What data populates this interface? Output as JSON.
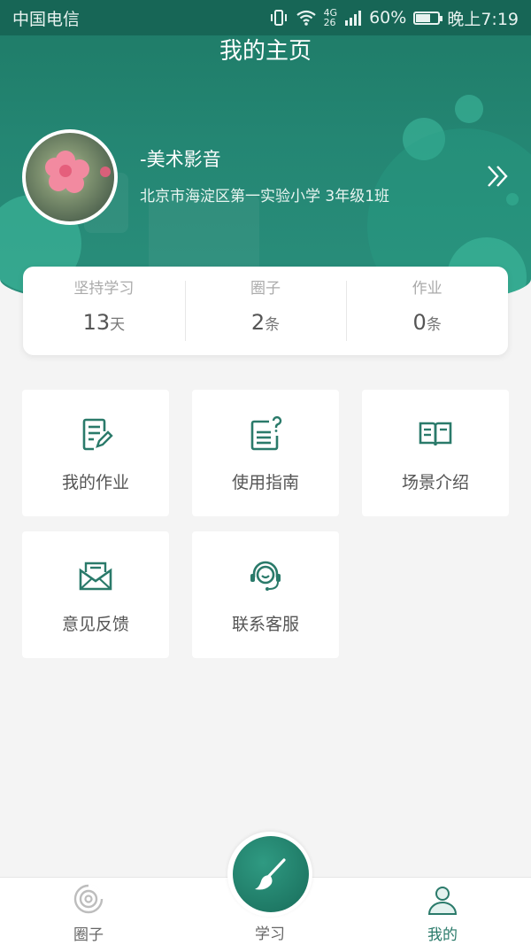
{
  "status_bar": {
    "carrier": "中国电信",
    "network_top": "4G",
    "network_bottom": "26",
    "battery": "60%",
    "time": "晚上7:19"
  },
  "header": {
    "title": "我的主页"
  },
  "profile": {
    "name": "-美术影音",
    "school": "北京市海淀区第一实验小学 3年级1班"
  },
  "stats": [
    {
      "label": "坚持学习",
      "value": "13",
      "unit": "天"
    },
    {
      "label": "圈子",
      "value": "2",
      "unit": "条"
    },
    {
      "label": "作业",
      "value": "0",
      "unit": "条"
    }
  ],
  "menu": [
    {
      "label": "我的作业",
      "icon": "edit-document-icon"
    },
    {
      "label": "使用指南",
      "icon": "guide-question-icon"
    },
    {
      "label": "场景介绍",
      "icon": "open-book-icon"
    },
    {
      "label": "意见反馈",
      "icon": "envelope-icon"
    },
    {
      "label": "联系客服",
      "icon": "headset-icon"
    }
  ],
  "bottom_nav": [
    {
      "label": "圈子",
      "icon": "circle-disc-icon",
      "active": false
    },
    {
      "label": "学习",
      "icon": "brush-icon",
      "active": false
    },
    {
      "label": "我的",
      "icon": "user-icon",
      "active": true
    }
  ],
  "colors": {
    "primary": "#1e7a66",
    "accent_light": "#40bea0",
    "icon": "#2a7a6a",
    "background": "#f4f4f4"
  }
}
